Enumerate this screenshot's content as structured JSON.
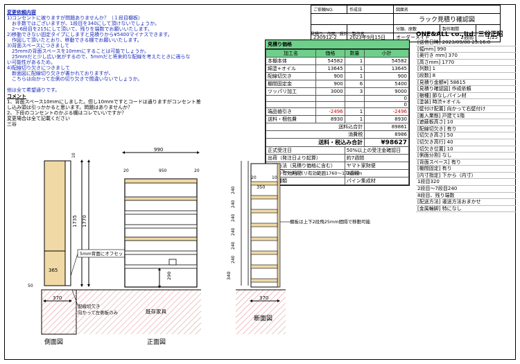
{
  "header": {
    "customer_no_label": "ご依頼NO.",
    "customer_no": "230912-2",
    "date_label": "作成日",
    "date": "2023年9月15日",
    "category_label": "分類、座敷",
    "category": "オーダーメイド",
    "lead_label": "製作期間",
    "lead": "2週間",
    "title_label": "図面名",
    "title": "ラック見積り確認図",
    "page": "1/25",
    "company_note": "見積り、作図、設計、製作者",
    "company": "ONE&ALL co.,ltd. 三谷正昭"
  },
  "notes": {
    "title": "変更依頼内容",
    "lines": [
      "1)コンセントに被りますが問題ありませんか？（１段目棚板）",
      "　お手数ではございますが、1段目を340にして頂けないでしょうか。",
      "　2～6段目を215にして頂いて、残りを端数でお願いいたします。",
      "2)移動できない固定タイプにしますと見積りから¥5400マイナスできます。",
      "　作図して頂いたとおり、移動できる棚でお願いいたします。",
      "3)背面スペースにつきまして",
      "　25mmの背面スペースを10mmにすることは可能でしょうか。",
      "　25mmだと少し広い気がするので、5mmだと将来的な配線を考えたときに適らな",
      "い可能性があるため。",
      "4)配線切り欠きにつきまして",
      "　新面図に配線切り欠きが書かれておりますが、",
      "　こちらは向かって左側の切り欠きで間違いないでしょうか。",
      "",
      "他は全て希望通りです。"
    ],
    "comment_title": "コメント",
    "comment_lines": [
      "1、背面スペース10mmにしました。但し10mmですとコードは通りますがコンセント差",
      "し込み頭は引っかかると思います。問題はありませんか？",
      "2、下段のコンセントのかぶる棚はコレでいいですか？",
      "変更場合は全て記載ください",
      "三谷"
    ]
  },
  "estimate": {
    "title": "見積り価格",
    "columns": [
      "加工名",
      "価格",
      "数量",
      "小計"
    ],
    "rows": [
      {
        "name": "本棚本体",
        "price": "54582",
        "qty": "1",
        "sub": "54582"
      },
      {
        "name": "綿塗+オイル",
        "price": "13645",
        "qty": "1",
        "sub": "13645"
      },
      {
        "name": "配線切欠き",
        "price": "900",
        "qty": "1",
        "sub": "900"
      },
      {
        "name": "棚間固定金",
        "price": "900",
        "qty": "6",
        "sub": "5400"
      },
      {
        "name": "ツッパリ加工",
        "price": "3000",
        "qty": "3",
        "sub": "9000"
      },
      {
        "name": "",
        "price": "",
        "qty": "",
        "sub": "0"
      },
      {
        "name": "",
        "price": "",
        "qty": "",
        "sub": "0"
      },
      {
        "name": "端品値引き",
        "price": "-2496",
        "qty": "1",
        "sub": "-2496"
      },
      {
        "name": "送料・梱包費",
        "price": "8930",
        "qty": "1",
        "sub": "8930"
      }
    ],
    "subtotal_label": "送料込合計",
    "subtotal": "89861",
    "tax_label": "消費税",
    "tax": "8986",
    "total_label": "送料・税込み合計",
    "total": "¥98627",
    "info": [
      [
        "正式受注日",
        "50%以上の受注金確認日"
      ],
      [
        "出荷（発注日より起算）",
        "約7週間"
      ],
      [
        "配送方法（見積り価格に含む）",
        "ヤマト家財便"
      ],
      [
        "受取り有効期間",
        "2週間"
      ],
      [
        "主材種類",
        "パイン集成材"
      ]
    ]
  },
  "spec": [
    "[送信日時] 2023/09/08 23:16:8",
    "[幅mm] 990",
    "[奥行き mm] 370",
    "[高さmm] 1770",
    "[列数] 1",
    "[段数] 8",
    "[見積り金額¥] 58615",
    "[見積り確認図] 作成依頼",
    "[樹種] 節なしパイン材",
    "[塗装] 時渋+オイル",
    "[壁付け配置] 向かって右壁付け",
    "[搬入業態] 戸建て1階",
    "[遮蔽板高さ] 10",
    "[配線切欠き] 有り",
    "[切欠き高さ] 50",
    "[切欠き高行] 40",
    "[切欠き位置] 10",
    "[側面分割] なし",
    "[背面スペース] 有り",
    "[棚間固定] 有り",
    "[内寸指定] 下から（内寸）",
    "1段目320",
    "2段目～7段目240",
    "8段目、残り端数",
    "[配送方法] 運送方法おまかせ",
    "[金属輪脚] 特になし"
  ],
  "drawing": {
    "side_label": "側面図",
    "front_label": "正面図",
    "section_label": "断面図",
    "dim_side_height": "1735",
    "dim_side_inner": "1770",
    "dim_side_top": "10",
    "dim_side_bottom1": "50",
    "dim_side_bottom2": "365",
    "dim_side_depth": "370",
    "dim_front_width": "990",
    "dim_front_inner": "950",
    "dim_front_side": "20",
    "dim_front_h1": "290",
    "dim_sec_depth": "350",
    "dim_sec_a": "20",
    "dim_sec_b": "10",
    "dim_sec_total": "370",
    "dim_sec_bottom": "340",
    "dim_sec_shelves": [
      "240",
      "240",
      "240",
      "240",
      "240",
      "240"
    ],
    "note_back": "5mm背面にオフセット",
    "note_cutout": "配線切欠き\n向かって左側板のみ",
    "note_furniture": "既存家具",
    "note_tsuppari": "ツッパリ有効範囲1760～1765mm",
    "note_shelf": "棚板は上下2段飛25mm間隔で移動可能"
  }
}
